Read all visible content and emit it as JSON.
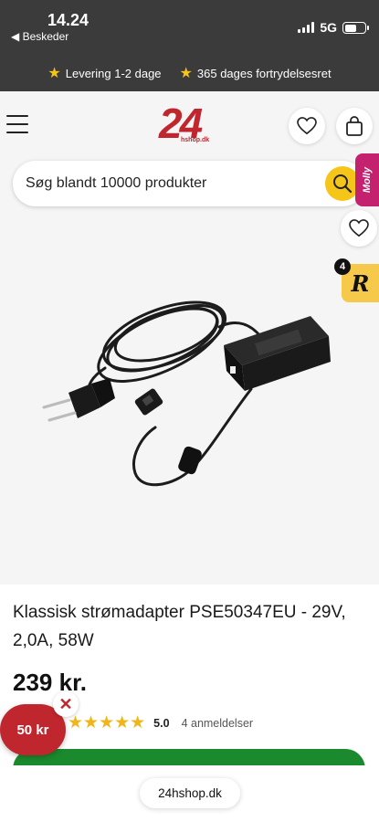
{
  "status_bar": {
    "time": "14.24",
    "back_label": "◀ Beskeder",
    "network": "5G"
  },
  "promo": {
    "items": [
      {
        "icon": "star-icon",
        "label": "Levering 1-2 dage"
      },
      {
        "icon": "star-icon",
        "label": "365 dages fortrydelsesret"
      }
    ]
  },
  "header": {
    "logo_number": "24",
    "logo_sub": "hshop.dk",
    "wishlist_icon": "heart-icon",
    "cart_icon": "shopping-bag-icon"
  },
  "search": {
    "placeholder": "Søg blandt 10000 produkter",
    "button_icon": "search-icon"
  },
  "side_tab": {
    "label": "Molly"
  },
  "product": {
    "title": "Klassisk strømadapter PSE50347EU - 29V, 2,0A, 58W",
    "price": "239 kr.",
    "rating_value": 5,
    "rating_text": "5.0",
    "reviews_text": "4 anmeldelser",
    "review_badge_count": "4",
    "review_badge_letter": "R",
    "image_icon": "power-adapter-image"
  },
  "voucher": {
    "label": "50 kr",
    "close": "✕"
  },
  "browser": {
    "url": "24hshop.dk"
  },
  "colors": {
    "brand_red": "#c0262d",
    "accent_yellow": "#f5c518",
    "cta_green": "#1b8a2e",
    "dark_bar": "#3b3b3b",
    "molly_pink": "#c4226f"
  }
}
